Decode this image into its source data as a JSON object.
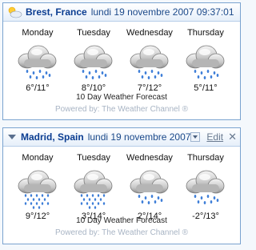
{
  "widgets": [
    {
      "city": "Brest, France",
      "datetime": "lundi 19 novembre 2007 09:37:01",
      "days": [
        {
          "name": "Monday",
          "temp": "6°/11°",
          "icon": "rain-cloud-icon"
        },
        {
          "name": "Tuesday",
          "temp": "8°/10°",
          "icon": "rain-cloud-icon"
        },
        {
          "name": "Wednesday",
          "temp": "7°/12°",
          "icon": "rain-cloud-icon"
        },
        {
          "name": "Thursday",
          "temp": "5°/11°",
          "icon": "rain-cloud-icon"
        }
      ],
      "forecast_link": "10 Day Weather Forecast",
      "powered_by": "Powered by: The Weather Channel ®"
    },
    {
      "city": "Madrid, Spain",
      "datetime": "lundi 19 novembre 2007",
      "edit_label": "Edit",
      "close_label": "✕",
      "days": [
        {
          "name": "Monday",
          "temp": "9°/12°",
          "icon": "heavy-rain-cloud-icon"
        },
        {
          "name": "Tuesday",
          "temp": "3°/14°",
          "icon": "heavy-rain-cloud-icon"
        },
        {
          "name": "Wednesday",
          "temp": "2°/14°",
          "icon": "rain-cloud-icon"
        },
        {
          "name": "Thursday",
          "temp": "-2°/13°",
          "icon": "rain-cloud-icon"
        }
      ],
      "forecast_link": "10 Day Weather Forecast",
      "powered_by": "Powered by: The Weather Channel ®"
    }
  ],
  "colors": {
    "accent": "#0b3d91",
    "border": "#7aa3cf",
    "rain": "#3f7fd8"
  }
}
